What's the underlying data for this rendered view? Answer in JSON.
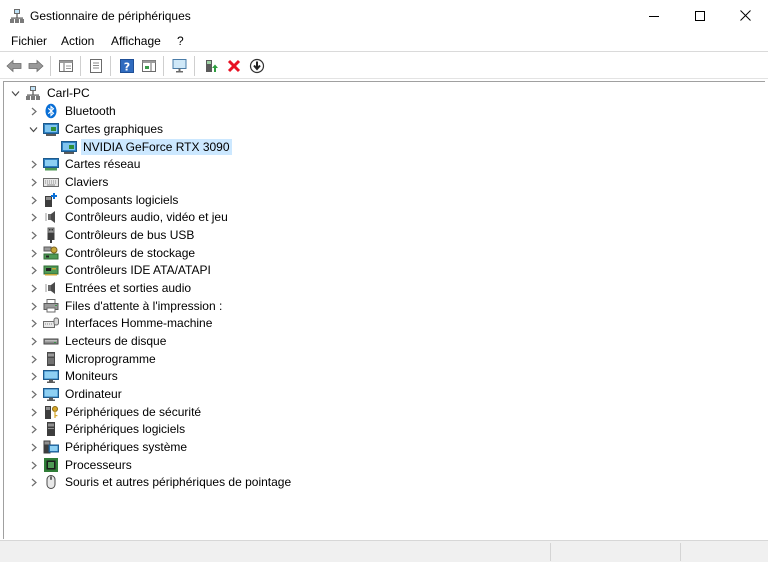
{
  "window": {
    "title": "Gestionnaire de périphériques",
    "icon": "device-manager-icon",
    "controls": [
      "minimize-icon",
      "maximize-icon",
      "close-icon"
    ]
  },
  "menu": [
    {
      "label": "Fichier"
    },
    {
      "label": "Action"
    },
    {
      "label": "Affichage"
    },
    {
      "label": "?"
    }
  ],
  "toolbar": [
    {
      "icon": "back-arrow-icon"
    },
    {
      "icon": "forward-arrow-icon"
    },
    {
      "icon": "show-hide-console-tree-icon"
    },
    {
      "icon": "properties-icon"
    },
    {
      "icon": "help-icon"
    },
    {
      "icon": "action-pane-icon"
    },
    {
      "icon": "scan-hardware-changes-icon"
    },
    {
      "icon": "update-driver-icon"
    },
    {
      "icon": "uninstall-device-icon"
    },
    {
      "icon": "disable-device-icon"
    }
  ],
  "tree": {
    "root": {
      "label": "Carl-PC",
      "icon": "computer-icon",
      "expanded": true
    },
    "categories": [
      {
        "label": "Bluetooth",
        "icon": "bluetooth-icon",
        "expanded": false
      },
      {
        "label": "Cartes graphiques",
        "icon": "display-adapter-icon",
        "expanded": true,
        "children": [
          {
            "label": "NVIDIA GeForce RTX 3090",
            "icon": "display-adapter-icon",
            "selected": true
          }
        ]
      },
      {
        "label": "Cartes réseau",
        "icon": "network-adapter-icon",
        "expanded": false
      },
      {
        "label": "Claviers",
        "icon": "keyboard-icon",
        "expanded": false
      },
      {
        "label": "Composants logiciels",
        "icon": "software-component-icon",
        "expanded": false
      },
      {
        "label": "Contrôleurs audio, vidéo et jeu",
        "icon": "speaker-icon",
        "expanded": false
      },
      {
        "label": "Contrôleurs de bus USB",
        "icon": "usb-icon",
        "expanded": false
      },
      {
        "label": "Contrôleurs de stockage",
        "icon": "storage-controller-icon",
        "expanded": false
      },
      {
        "label": "Contrôleurs IDE ATA/ATAPI",
        "icon": "ide-controller-icon",
        "expanded": false
      },
      {
        "label": "Entrées et sorties audio",
        "icon": "speaker-icon",
        "expanded": false
      },
      {
        "label": "Files d'attente à l'impression :",
        "icon": "printer-icon",
        "expanded": false
      },
      {
        "label": "Interfaces Homme-machine",
        "icon": "hid-icon",
        "expanded": false
      },
      {
        "label": "Lecteurs de disque",
        "icon": "disk-drive-icon",
        "expanded": false
      },
      {
        "label": "Microprogramme",
        "icon": "firmware-icon",
        "expanded": false
      },
      {
        "label": "Moniteurs",
        "icon": "monitor-icon",
        "expanded": false
      },
      {
        "label": "Ordinateur",
        "icon": "monitor-icon",
        "expanded": false
      },
      {
        "label": "Périphériques de sécurité",
        "icon": "security-device-icon",
        "expanded": false
      },
      {
        "label": "Périphériques logiciels",
        "icon": "software-device-icon",
        "expanded": false
      },
      {
        "label": "Périphériques système",
        "icon": "system-device-icon",
        "expanded": false
      },
      {
        "label": "Processeurs",
        "icon": "processor-icon",
        "expanded": false
      },
      {
        "label": "Souris et autres périphériques de pointage",
        "icon": "mouse-icon",
        "expanded": false
      }
    ]
  },
  "colors": {
    "selection": "#cce8ff",
    "uninstall_red": "#e81123",
    "update_green": "#2e9e3f",
    "chevron": "#6e6e6e"
  }
}
